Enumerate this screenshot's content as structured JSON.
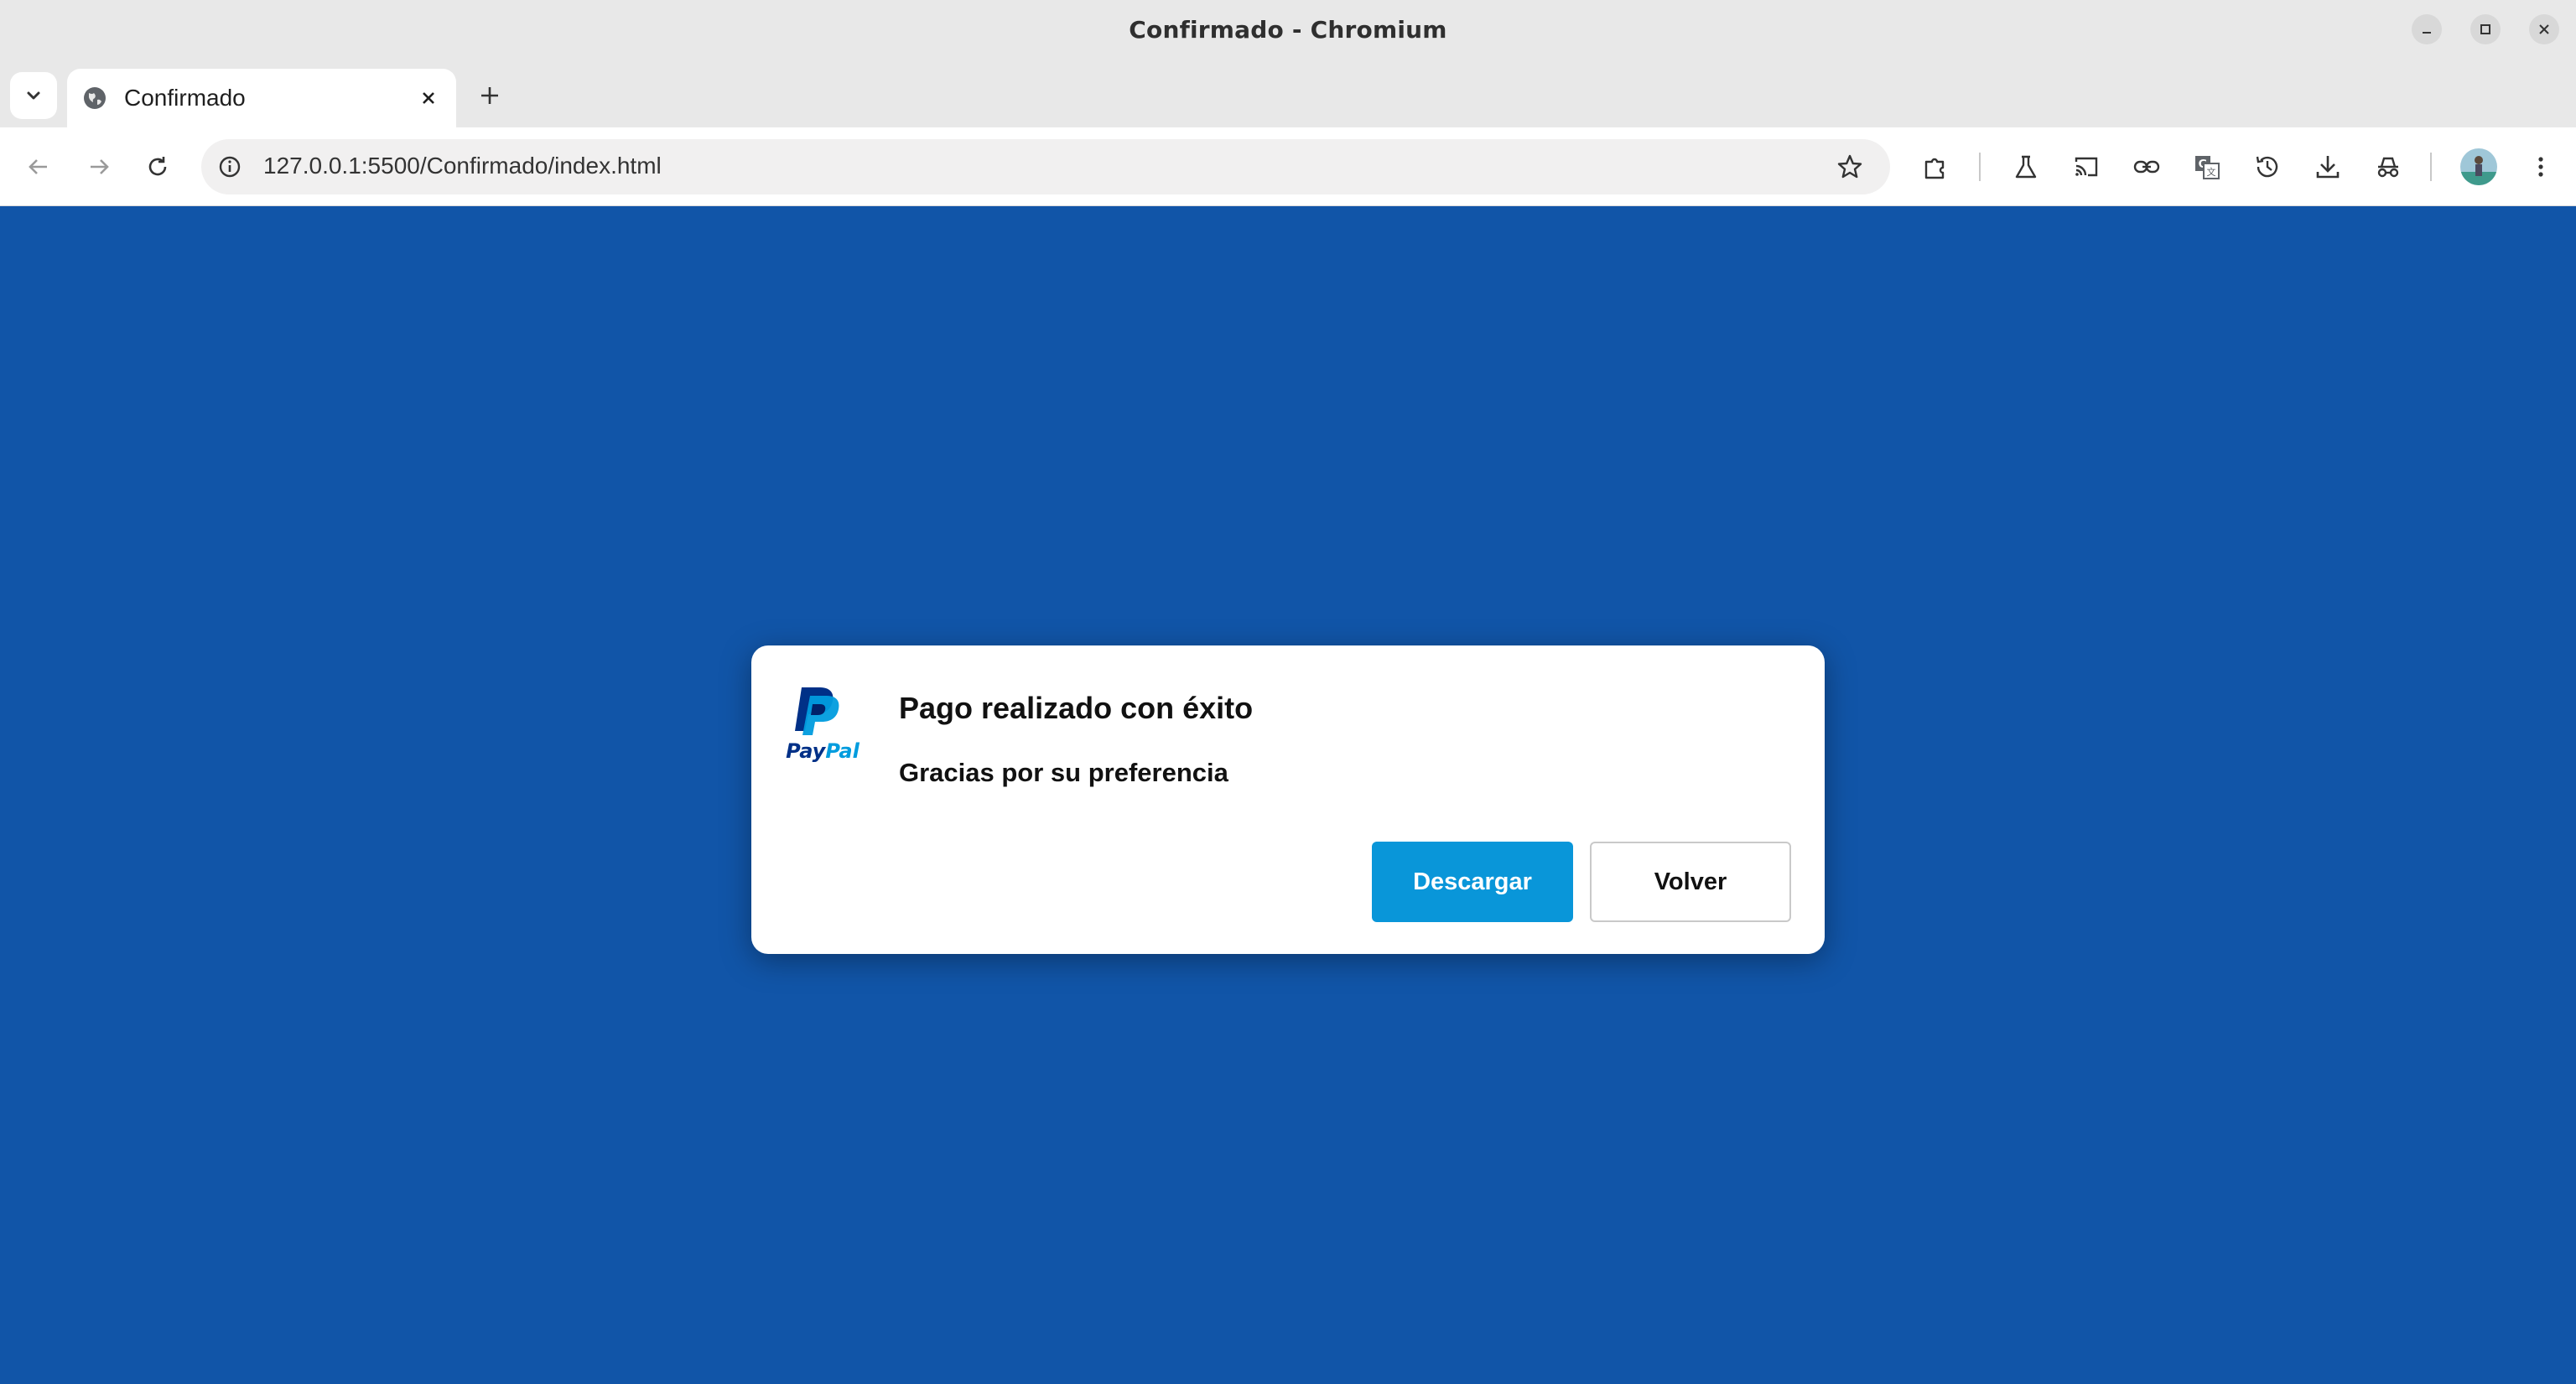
{
  "window": {
    "title": "Confirmado - Chromium"
  },
  "tabs": [
    {
      "label": "Confirmado",
      "icon": "globe-icon"
    }
  ],
  "toolbar": {
    "url": "127.0.0.1:5500/Confirmado/index.html"
  },
  "dialog": {
    "logo_text": "PayPal",
    "title": "Pago realizado con éxito",
    "subtitle": "Gracias por su preferencia",
    "primary_label": "Descargar",
    "secondary_label": "Volver"
  },
  "colors": {
    "page_background": "#1155a8",
    "primary_button": "#0996d9",
    "paypal_dark": "#003087",
    "paypal_light": "#009cde"
  }
}
